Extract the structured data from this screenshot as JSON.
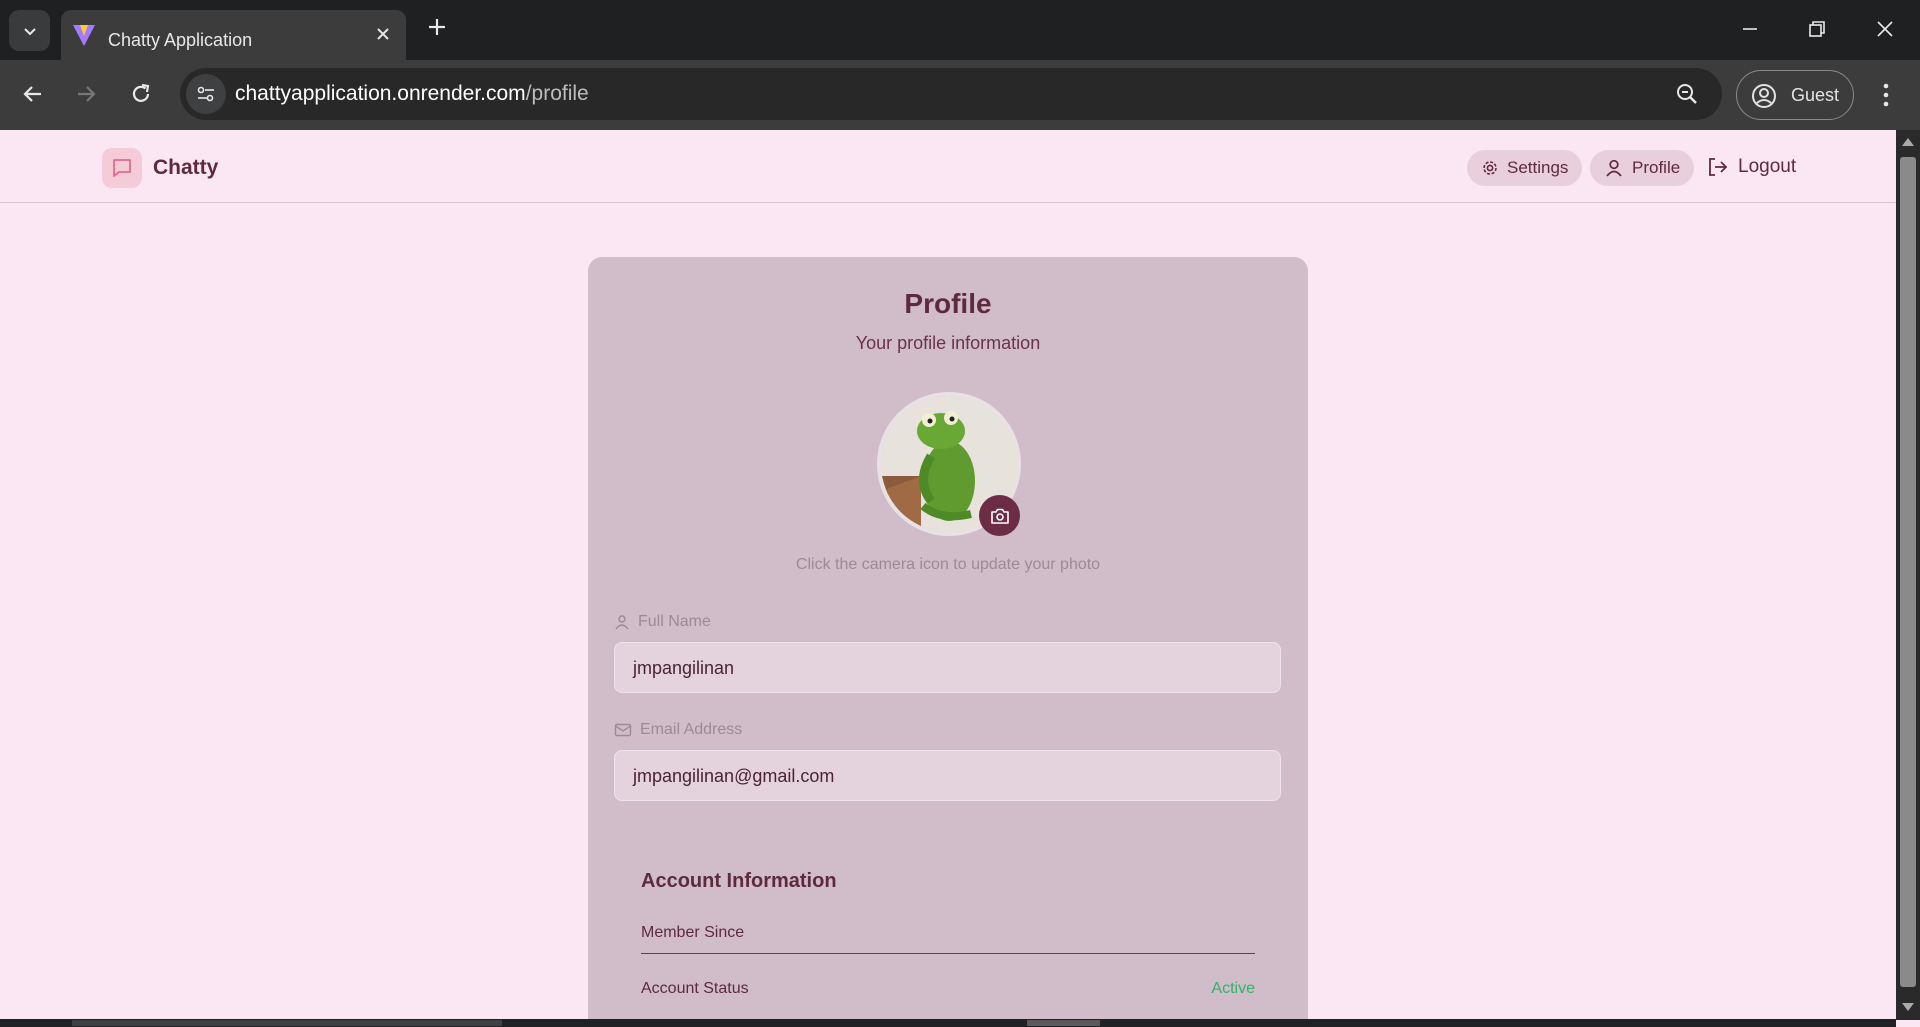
{
  "browser": {
    "tab_title": "Chatty Application",
    "url_host": "chattyapplication.onrender.com",
    "url_path": "/profile",
    "profile_label": "Guest"
  },
  "header": {
    "brand": "Chatty",
    "settings_label": "Settings",
    "profile_label": "Profile",
    "logout_label": "Logout"
  },
  "profile": {
    "title": "Profile",
    "subtitle": "Your profile information",
    "photo_hint": "Click the camera icon to update your photo",
    "full_name_label": "Full Name",
    "full_name_value": "jmpangilinan",
    "email_label": "Email Address",
    "email_value": "jmpangilinan@gmail.com"
  },
  "account": {
    "title": "Account Information",
    "member_since_label": "Member Since",
    "status_label": "Account Status",
    "status_value": "Active",
    "status_color": "#2fb36b"
  },
  "colors": {
    "page_bg": "#fbe7f3",
    "card_bg": "#d0bdc9",
    "accent": "#6b2c44"
  },
  "icons": [
    "chevron-down-icon",
    "vite-favicon-icon",
    "close-icon",
    "plus-icon",
    "minimize-icon",
    "restore-icon",
    "window-close-icon",
    "back-icon",
    "forward-icon",
    "reload-icon",
    "site-info-icon",
    "zoom-icon",
    "guest-profile-icon",
    "more-vert-icon",
    "message-square-icon",
    "gear-icon",
    "user-icon",
    "logout-icon",
    "camera-icon",
    "mail-icon"
  ]
}
